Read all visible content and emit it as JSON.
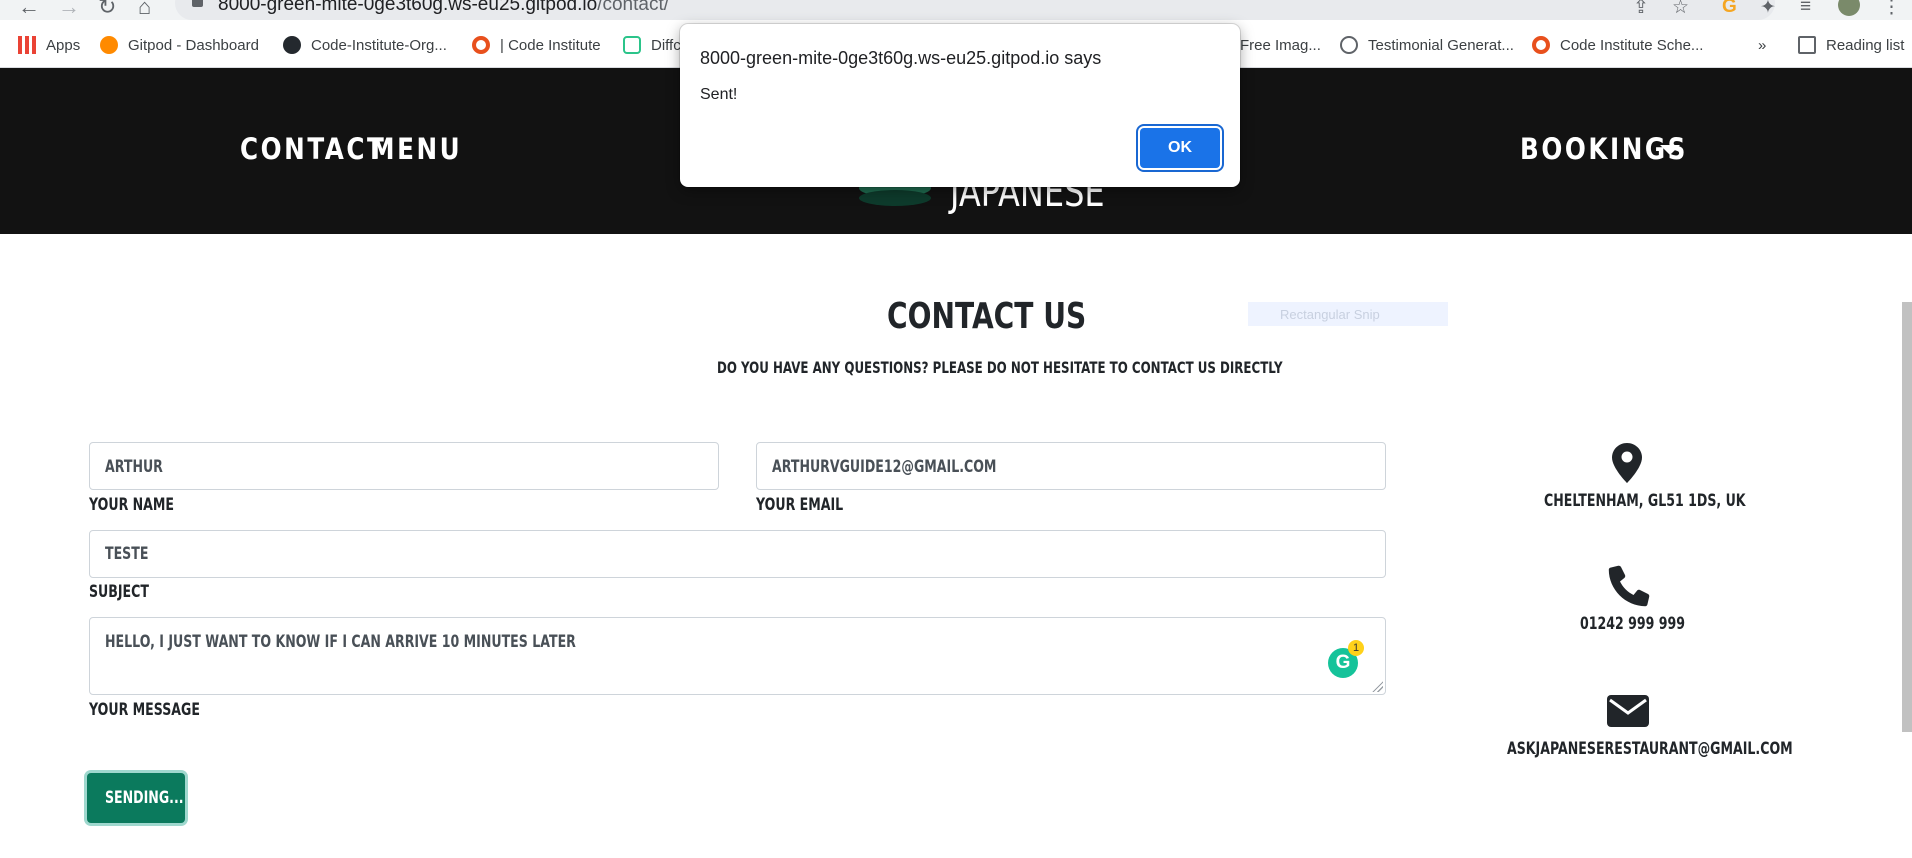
{
  "browser": {
    "url_host": "8000-green-mite-0ge3t60g.ws-eu25.gitpod.io",
    "url_path": "/contact/",
    "bookmarks": [
      "Apps",
      "Gitpod - Dashboard",
      "Code-Institute-Org...",
      "| Code Institute",
      "Diffc",
      "Free Imag...",
      "Testimonial Generat...",
      "Code Institute Sche...",
      "»",
      "Reading list"
    ]
  },
  "header": {
    "nav_contact": "CONTACT",
    "nav_menu": "MENU",
    "nav_bookings": "BOOKINGS",
    "logo_text": "JAPANESE"
  },
  "main": {
    "title": "CONTACT US",
    "subtitle": "DO YOU HAVE ANY QUESTIONS? PLEASE DO NOT HESITATE TO CONTACT US DIRECTLY"
  },
  "form": {
    "name_value": "ARTHUR",
    "name_label": "YOUR NAME",
    "email_value": "ARTHURVGUIDE12@GMAIL.COM",
    "email_label": "YOUR EMAIL",
    "subject_value": "TESTE",
    "subject_label": "SUBJECT",
    "message_value": "HELLO, I JUST WANT TO KNOW IF I CAN ARRIVE 10 MINUTES LATER",
    "message_label": "YOUR MESSAGE",
    "grammarly_count": "1",
    "submit_label": "SENDING..."
  },
  "contact_info": {
    "address": "CHELTENHAM, GL51 1DS, UK",
    "phone": "01242 999 999",
    "email": "ASKJAPANESERESTAURANT@GMAIL.COM"
  },
  "overlay": {
    "snip_label": "Rectangular Snip"
  },
  "dialog": {
    "title": "8000-green-mite-0ge3t60g.ws-eu25.gitpod.io says",
    "message": "Sent!",
    "ok_label": "OK"
  },
  "colors": {
    "header_bg": "#121212",
    "brand_green": "#0b7a5d",
    "dialog_button": "#1a73e8"
  }
}
